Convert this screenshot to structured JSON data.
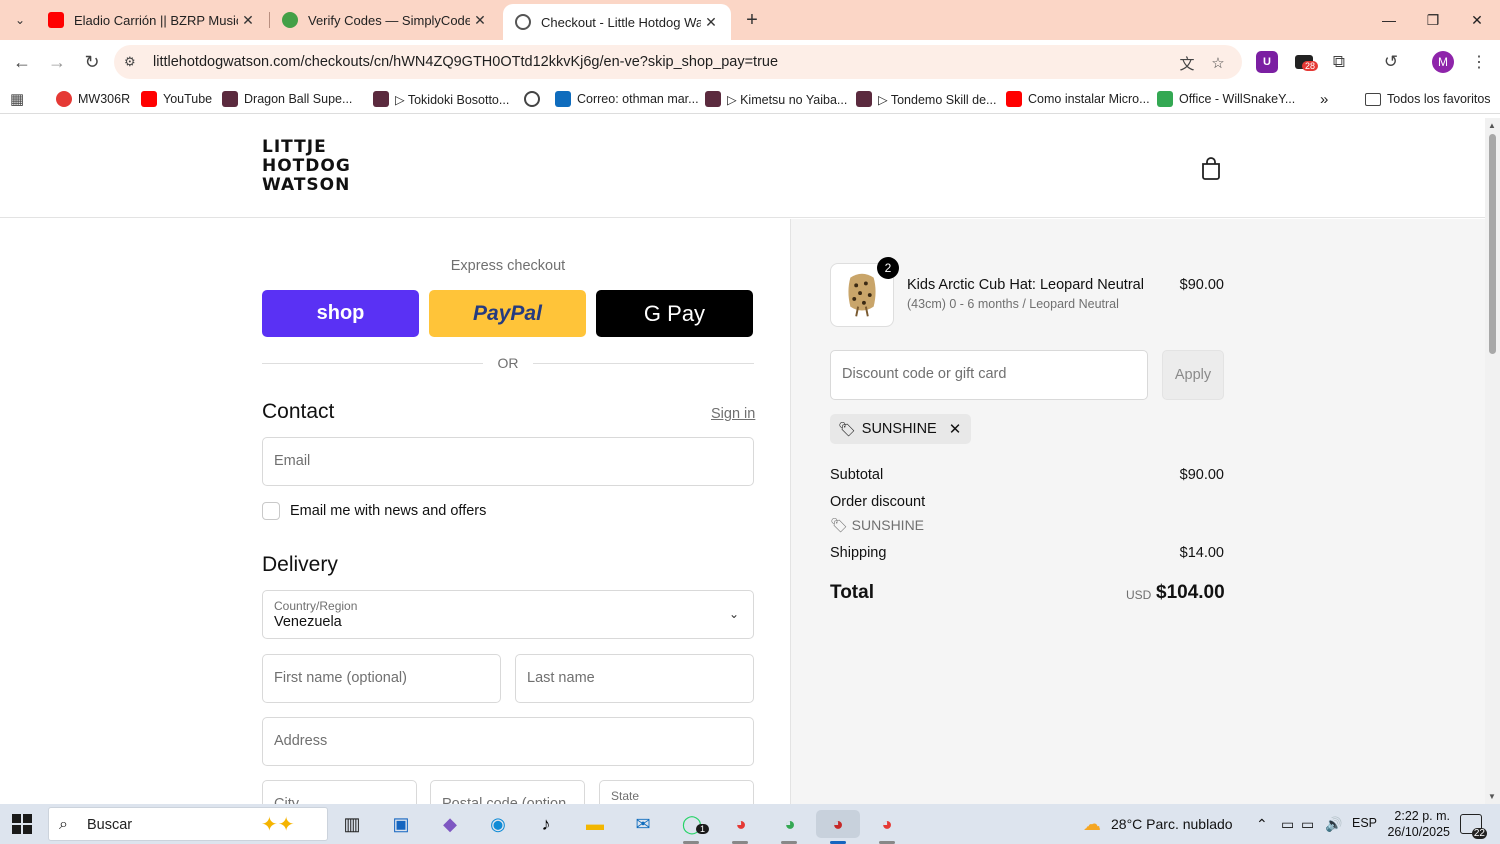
{
  "browser": {
    "tabs": [
      {
        "title": "Eladio Carrión || BZRP Music Se",
        "favicon": "youtube-icon",
        "color": "#ff0000"
      },
      {
        "title": "Verify Codes — SimplyCodes",
        "favicon": "simplycodes-icon",
        "color": "#2e7d32"
      },
      {
        "title": "Checkout - Little Hotdog Watso",
        "favicon": "globe-icon",
        "color": "#555555"
      }
    ],
    "url": "littlehotdogwatson.com/checkouts/cn/hWN4ZQ9GTH0OTtd12kkvKj6g/en-ve?skip_shop_pay=true",
    "extensions_badge": "28",
    "profile_initial": "M",
    "bookmarks": [
      {
        "label": "MW306R",
        "icon_color": "#e53935"
      },
      {
        "label": "YouTube",
        "icon_color": "#ff0000"
      },
      {
        "label": "Dragon Ball Supe...",
        "icon_color": "#5b2a3e"
      },
      {
        "label": "▷ Tokidoki Bosotto...",
        "icon_color": "#5b2a3e"
      },
      {
        "label": "",
        "icon_color": "#444444"
      },
      {
        "label": "Correo: othman mar...",
        "icon_color": "#0f6cbd"
      },
      {
        "label": "▷ Kimetsu no Yaiba...",
        "icon_color": "#5b2a3e"
      },
      {
        "label": "▷ Tondemo Skill de...",
        "icon_color": "#5b2a3e"
      },
      {
        "label": "Como instalar Micro...",
        "icon_color": "#ff0000"
      },
      {
        "label": "Office - WillSnakeY...",
        "icon_color": "#34a853"
      }
    ],
    "all_bookmarks": "Todos los favoritos"
  },
  "store": {
    "logo_lines": [
      "LITTJE",
      "HOTDOG",
      "WATSON"
    ]
  },
  "checkout": {
    "express_title": "Express checkout",
    "shop_label": "shop",
    "paypal_label": "PayPal",
    "gpay_label": "G Pay",
    "or_label": "OR",
    "contact_title": "Contact",
    "signin_label": "Sign in",
    "email_placeholder": "Email",
    "newsletter_label": "Email me with news and offers",
    "delivery_title": "Delivery",
    "country_label": "Country/Region",
    "country_value": "Venezuela",
    "first_name_placeholder": "First name (optional)",
    "last_name_placeholder": "Last name",
    "address_placeholder": "Address",
    "city_placeholder": "City",
    "postal_placeholder": "Postal code (option",
    "state_label": "State"
  },
  "summary": {
    "item": {
      "quantity": "2",
      "name": "Kids Arctic Cub Hat: Leopard Neutral",
      "variant": "(43cm) 0 - 6 months / Leopard Neutral",
      "price": "$90.00"
    },
    "discount_placeholder": "Discount code or gift card",
    "apply_label": "Apply",
    "applied_code": "SUNSHINE",
    "subtotal_label": "Subtotal",
    "subtotal_value": "$90.00",
    "order_discount_label": "Order discount",
    "order_discount_code": "SUNSHINE",
    "shipping_label": "Shipping",
    "shipping_value": "$14.00",
    "total_label": "Total",
    "currency": "USD",
    "total_value": "$104.00"
  },
  "taskbar": {
    "search_placeholder": "Buscar",
    "whatsapp_badge": "1",
    "weather": "28°C  Parc. nublado",
    "language": "ESP",
    "time": "2:22 p. m.",
    "date": "26/10/2025",
    "notifications": "22"
  },
  "colors": {
    "tabbar_bg": "#fbd6c6",
    "shop_pay": "#5a31f4",
    "paypal": "#ffc439",
    "gpay": "#000000",
    "summary_bg": "#f5f5f5"
  }
}
